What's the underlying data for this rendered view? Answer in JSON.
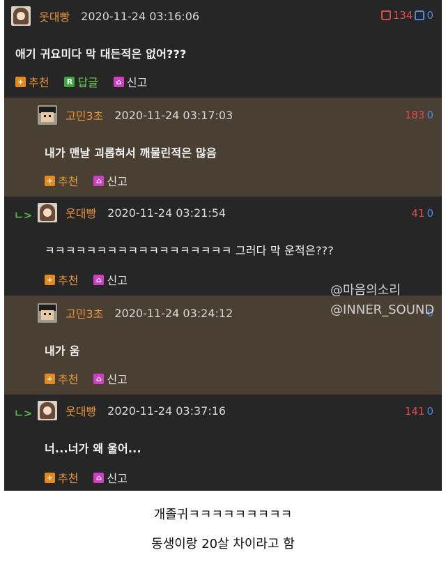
{
  "comments": [
    {
      "nick": "웃대빵",
      "timestamp": "2020-11-24 03:16:06",
      "up": "134",
      "down": "0",
      "text": "애기 귀요미다 막 대든적은 없어???",
      "actions": {
        "recommend": "추천",
        "reply": "답글",
        "report": "신고"
      }
    },
    {
      "nick": "고민3초",
      "timestamp": "2020-11-24 03:17:03",
      "up": "183",
      "down": "0",
      "text": "내가 맨날 괴롭혀서 깨물린적은 많음",
      "actions": {
        "recommend": "추천",
        "report": "신고"
      }
    },
    {
      "nick": "웃대빵",
      "timestamp": "2020-11-24 03:21:54",
      "up": "41",
      "down": "0",
      "text": "ㅋㅋㅋㅋㅋㅋㅋㅋㅋㅋㅋㅋㅋㅋㅋㅋㅋㅋ 그러다 막 운적은???",
      "actions": {
        "recommend": "추천",
        "report": "신고"
      }
    },
    {
      "nick": "고민3초",
      "timestamp": "2020-11-24 03:24:12",
      "up": "",
      "down": "0",
      "text": "내가 움",
      "actions": {
        "recommend": "추천",
        "report": "신고"
      }
    },
    {
      "nick": "웃대빵",
      "timestamp": "2020-11-24 03:37:16",
      "up": "141",
      "down": "0",
      "text": "너...너가 왜 울어...",
      "actions": {
        "recommend": "추천",
        "report": "신고"
      }
    }
  ],
  "reply_marker": "ㄴ>",
  "watermark": {
    "line1": "@마음의소리",
    "line2": "@INNER_SOUND"
  },
  "caption": {
    "line1": "개졸귀ㅋㅋㅋㅋㅋㅋㅋㅋㅋ",
    "line2": "동생이랑 20살 차이라고 함"
  },
  "colors": {
    "dark_bg": "#262626",
    "reply_bg": "#4a3f33",
    "nick": "#e8933e",
    "upvote": "#e14a4a",
    "downvote": "#4a8ae0"
  },
  "icons": {
    "recommend": "plus-icon",
    "reply": "reply-r-icon",
    "report": "bell-icon"
  }
}
